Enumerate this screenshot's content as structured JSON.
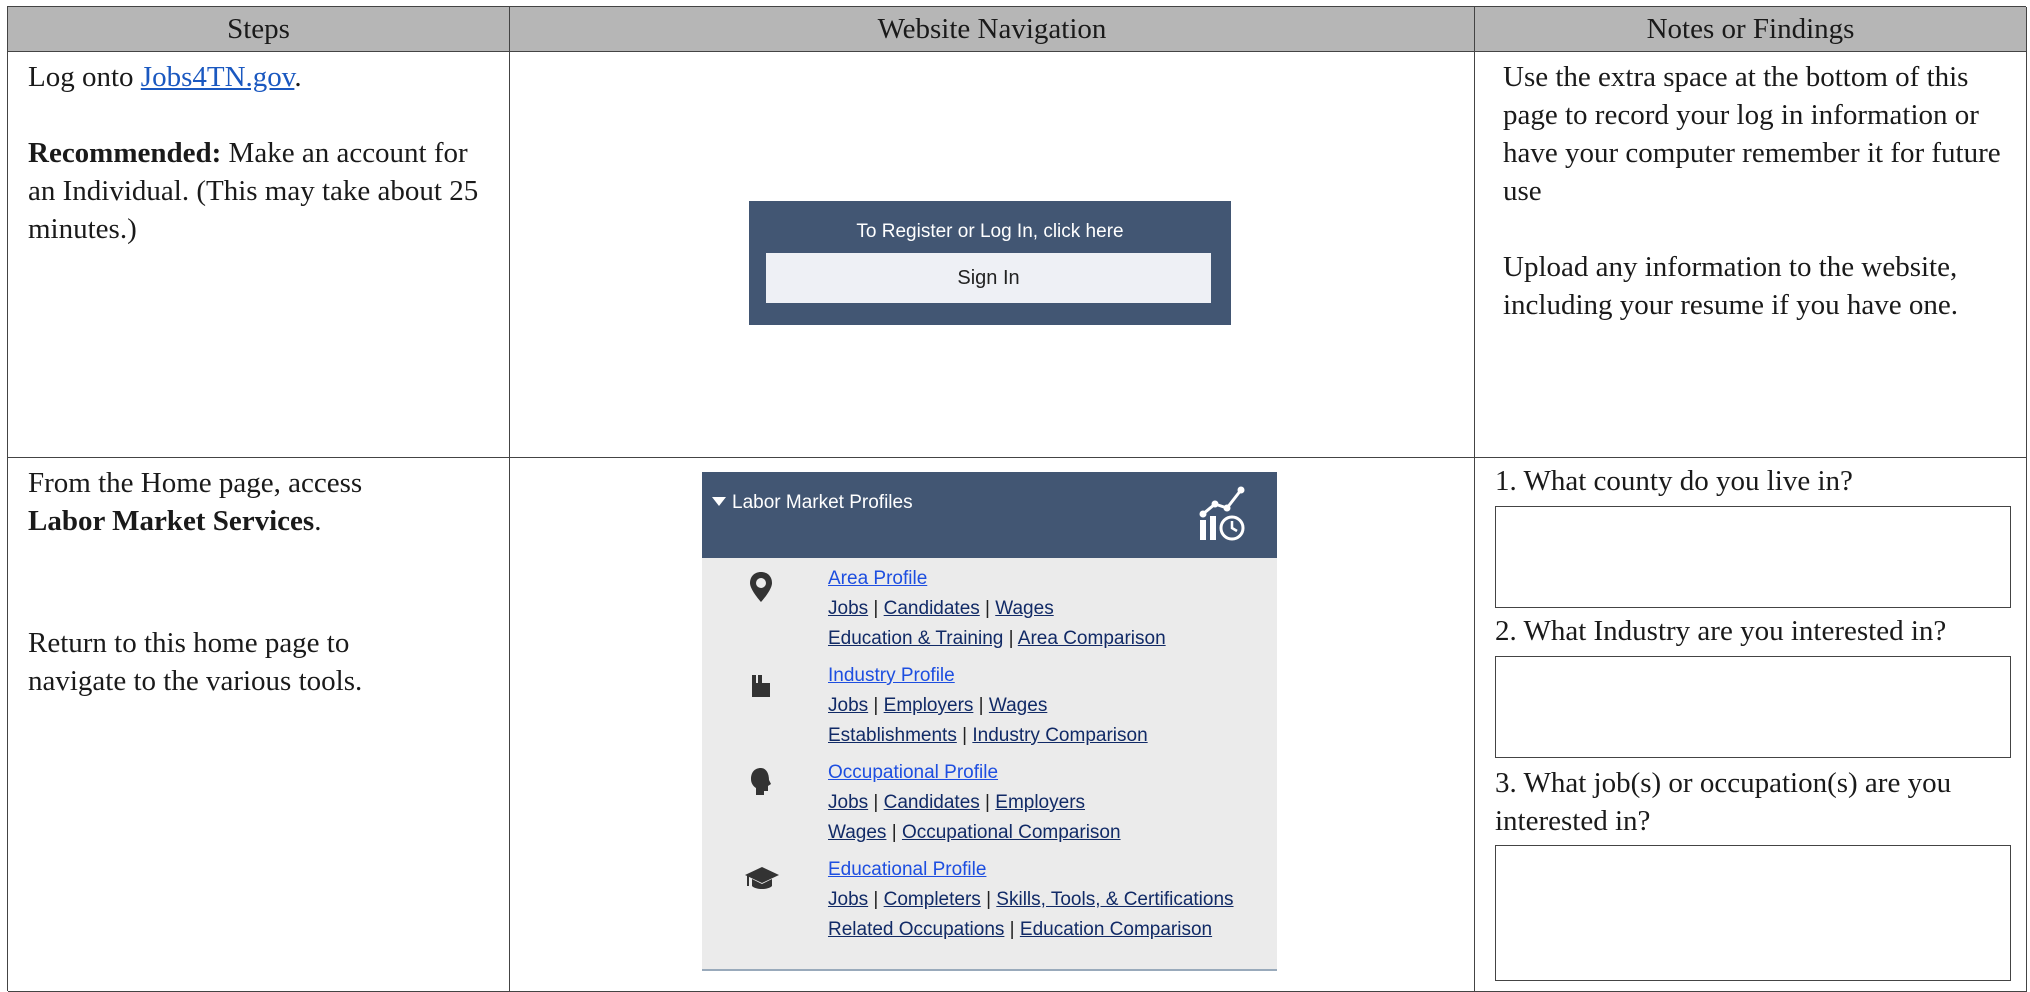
{
  "headers": {
    "steps": "Steps",
    "navigation": "Website Navigation",
    "notes": "Notes or Findings"
  },
  "row1": {
    "step_prefix": "Log onto ",
    "step_link": "Jobs4TN.gov",
    "step_suffix": ".",
    "recommended_label": "Recommended:",
    "recommended_text": " Make an account for an Individual. (This may take about 25 minutes.)",
    "signin_caption": "To Register or Log In, click here",
    "signin_button": "Sign In",
    "note1": "Use the extra space at the bottom of this page to record your log in information or have your computer remember it for future use",
    "note2": "Upload any information to the website, including your resume if you have one."
  },
  "row2": {
    "step_prefix": "From the Home page, access",
    "step_bold": "Labor Market Services",
    "step_suffix": ".",
    "step2": "Return to this home page to navigate to the various tools.",
    "widget": {
      "title": "Labor Market Profiles",
      "sections": [
        {
          "icon": "location-pin-icon",
          "head": "Area Profile",
          "lines": [
            [
              "Jobs",
              "Candidates",
              "Wages"
            ],
            [
              "Education & Training",
              "Area Comparison"
            ]
          ]
        },
        {
          "icon": "factory-icon",
          "head": "Industry Profile",
          "lines": [
            [
              "Jobs",
              "Employers",
              "Wages"
            ],
            [
              "Establishments",
              "Industry Comparison"
            ]
          ]
        },
        {
          "icon": "person-head-icon",
          "head": "Occupational Profile",
          "lines": [
            [
              "Jobs",
              "Candidates",
              "Employers"
            ],
            [
              "Wages",
              "Occupational Comparison"
            ]
          ]
        },
        {
          "icon": "graduation-cap-icon",
          "head": "Educational Profile",
          "lines": [
            [
              "Jobs",
              "Completers",
              "Skills, Tools, & Certifications"
            ],
            [
              "Related Occupations",
              "Education Comparison"
            ]
          ]
        }
      ]
    },
    "q1": "1. What county do you live in?",
    "q2": "2. What Industry are you interested in?",
    "q3": "3. What job(s) or occupation(s) are you interested in?"
  }
}
